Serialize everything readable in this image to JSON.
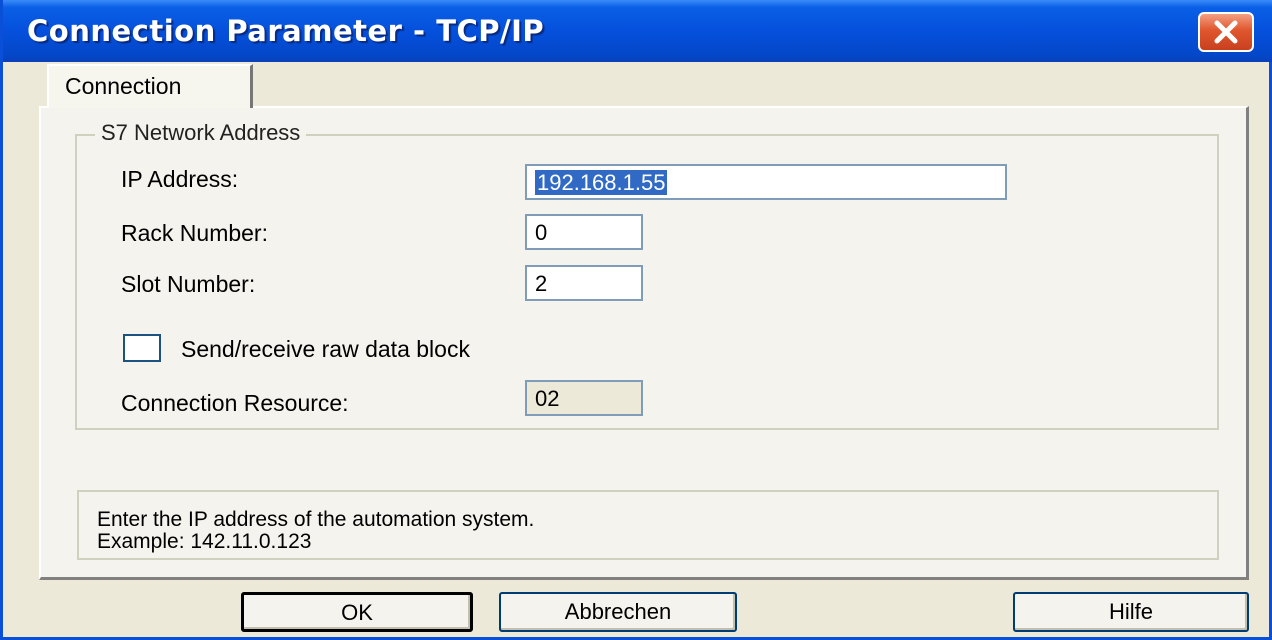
{
  "window": {
    "title": "Connection Parameter - TCP/IP"
  },
  "tabs": [
    {
      "label": "Connection"
    }
  ],
  "group": {
    "title": "S7 Network Address",
    "ip_label": "IP Address:",
    "ip_value": "192.168.1.55",
    "rack_label": "Rack Number:",
    "rack_value": "0",
    "slot_label": "Slot Number:",
    "slot_value": "2",
    "raw_label": "Send/receive raw data block",
    "raw_checked": false,
    "resource_label": "Connection Resource:",
    "resource_value": "02"
  },
  "hint": {
    "line1": "Enter the IP address of the automation system.",
    "line2": "Example: 142.11.0.123"
  },
  "buttons": {
    "ok": "OK",
    "cancel": "Abbrechen",
    "help": "Hilfe"
  },
  "colors": {
    "titlebar": "#0550dc",
    "selection": "#316ac5",
    "close": "#e0562e"
  }
}
